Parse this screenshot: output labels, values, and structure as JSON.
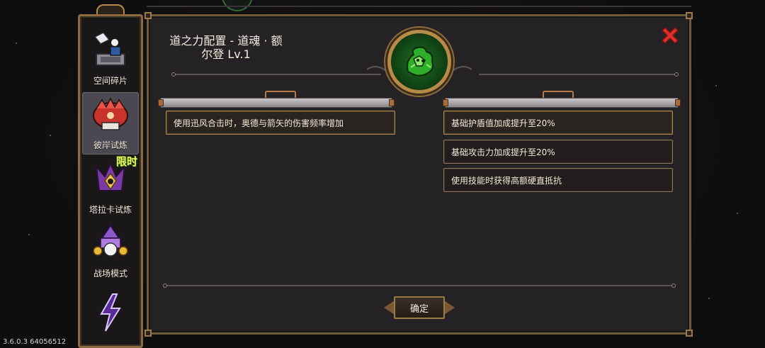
{
  "sidebar": {
    "items": [
      {
        "label": "空间碎片",
        "icon": "space-fragment-icon"
      },
      {
        "label": "彼岸试炼",
        "icon": "other-shore-trial-icon"
      },
      {
        "label": "塔拉卡试炼",
        "icon": "taraka-trial-icon",
        "tag": "限时"
      },
      {
        "label": "战场模式",
        "icon": "battlefield-mode-icon"
      },
      {
        "label": "",
        "icon": "lightning-mode-icon"
      }
    ]
  },
  "panel": {
    "title": "道之力配置 - 道魂 · 额尔登 Lv.1",
    "emblem_icon": "dao-soul-emblem-icon",
    "left_effects": [
      {
        "text": "使用迅风合击时，奥德与箭矢的伤害频率增加"
      }
    ],
    "right_effects": [
      {
        "text": "基础护盾值加成提升至20%"
      },
      {
        "text": "基础攻击力加成提升至20%"
      },
      {
        "text": "使用技能时获得高额硬直抵抗"
      }
    ],
    "confirm_label": "确定"
  },
  "version": "3.6.0.3 64056512",
  "colors": {
    "frame_gold": "#8a6a3e",
    "emblem_green": "#1f6e20",
    "close_red": "#d9302a",
    "panel_bg": "#252226"
  }
}
